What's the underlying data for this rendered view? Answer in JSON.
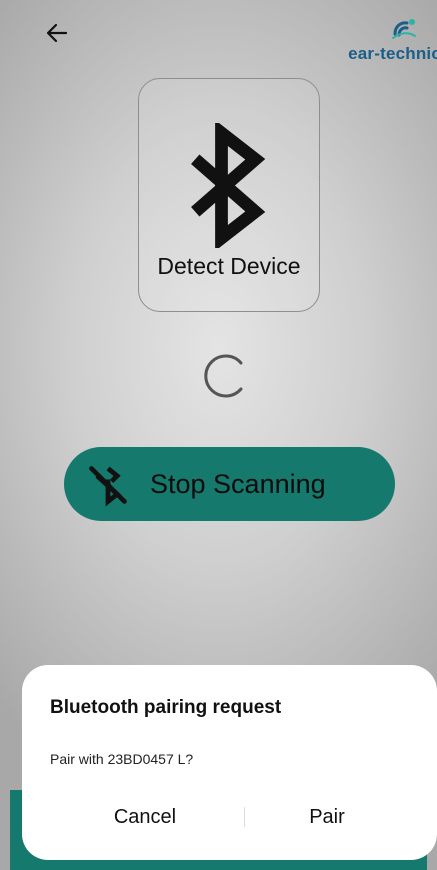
{
  "header": {
    "back_icon": "arrow-left-icon",
    "logo_text": "ear-technic"
  },
  "detect": {
    "icon": "bluetooth-icon",
    "label": "Detect Device"
  },
  "scan": {
    "spinner_icon": "loading-spinner-icon",
    "button_icon": "bluetooth-disabled-icon",
    "button_label": "Stop Scanning"
  },
  "dialog": {
    "title": "Bluetooth pairing request",
    "message": "Pair with 23BD0457 L?",
    "cancel_label": "Cancel",
    "pair_label": "Pair"
  },
  "colors": {
    "accent": "#157a6d",
    "logo": "#1a5e8a",
    "background": "#cfcfcf"
  }
}
